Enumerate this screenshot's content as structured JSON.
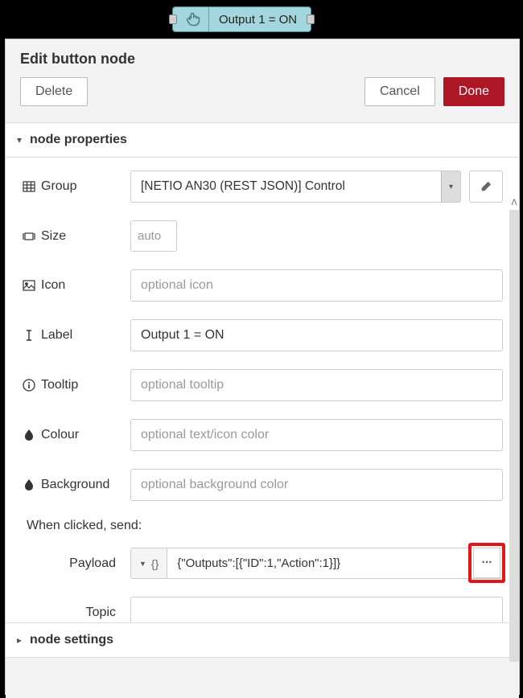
{
  "node": {
    "label": "Output 1 = ON"
  },
  "panel": {
    "title": "Edit button node",
    "delete_label": "Delete",
    "cancel_label": "Cancel",
    "done_label": "Done"
  },
  "sections": {
    "properties_title": "node properties",
    "settings_title": "node settings"
  },
  "form": {
    "group": {
      "label": "Group",
      "value": "[NETIO AN30 (REST JSON)] Control"
    },
    "size": {
      "label": "Size",
      "value": "auto"
    },
    "icon": {
      "label": "Icon",
      "placeholder": "optional icon"
    },
    "label_field": {
      "label": "Label",
      "value": "Output 1 = ON"
    },
    "tooltip": {
      "label": "Tooltip",
      "placeholder": "optional tooltip"
    },
    "colour": {
      "label": "Colour",
      "placeholder": "optional text/icon color"
    },
    "background": {
      "label": "Background",
      "placeholder": "optional background color"
    },
    "when_clicked": "When clicked, send:",
    "payload": {
      "label": "Payload",
      "value": "{\"Outputs\":[{\"ID\":1,\"Action\":1}]}"
    },
    "topic": {
      "label": "Topic"
    }
  }
}
